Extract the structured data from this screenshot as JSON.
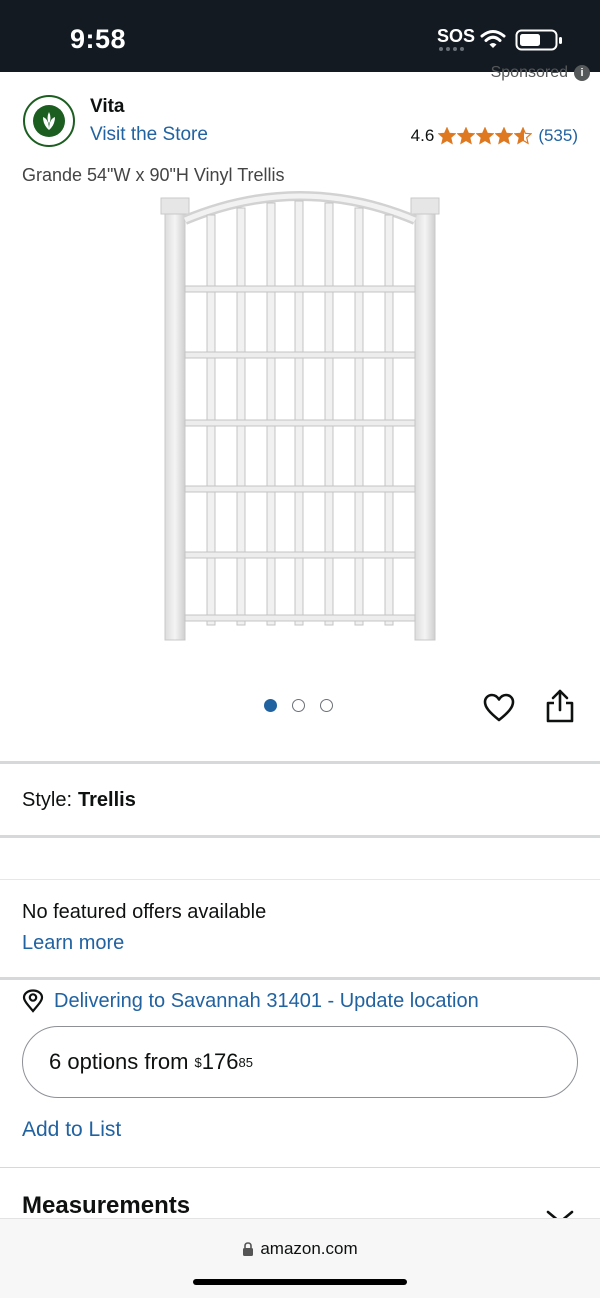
{
  "status_bar": {
    "time": "9:58",
    "sos": "SOS"
  },
  "sponsored": {
    "label": "Sponsored"
  },
  "brand": {
    "name": "Vita",
    "store_link": "Visit the Store",
    "rating_value": "4.6",
    "rating": 4.6,
    "review_count": "(535)",
    "accent_color": "#2162a1",
    "star_color": "#de7921"
  },
  "product": {
    "title": "Grande 54\"W x 90\"H Vinyl Trellis",
    "image_icon": "trellis-product-image"
  },
  "carousel": {
    "total": 3,
    "active_index": 0
  },
  "style": {
    "label": "Style:",
    "value": "Trellis"
  },
  "offers": {
    "message": "No featured offers available",
    "learn_more": "Learn more"
  },
  "delivery": {
    "text": "Delivering to Savannah 31401 - Update location"
  },
  "options": {
    "prefix": "6 options from",
    "currency": "$",
    "dollars": "176",
    "cents": "85"
  },
  "add_to_list": "Add to List",
  "measurements": {
    "title": "Measurements"
  },
  "browser": {
    "url": "amazon.com"
  }
}
